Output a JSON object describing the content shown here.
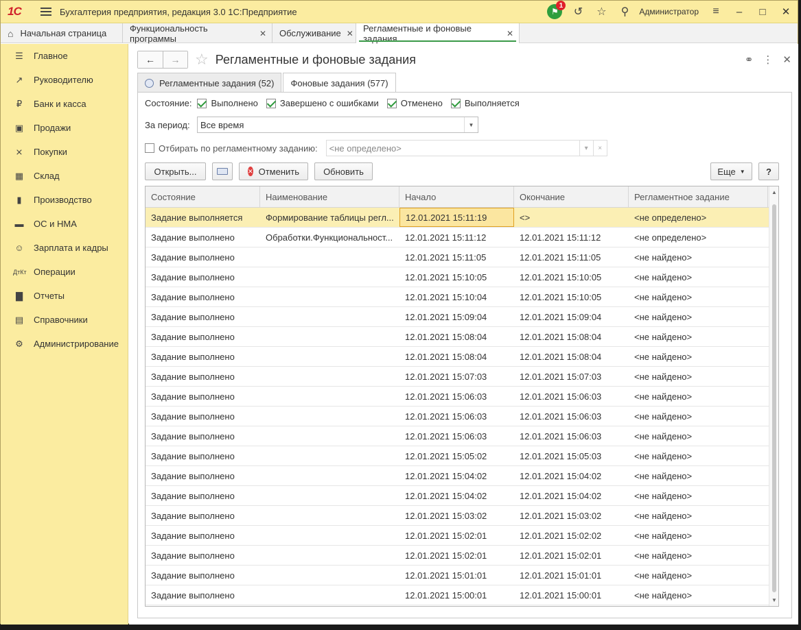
{
  "titlebar": {
    "app_title": "Бухгалтерия предприятия, редакция 3.0 1С:Предприятие",
    "logo_text": "1С",
    "notifications_count": "1",
    "user": "Администратор"
  },
  "tabs": [
    {
      "label": "Начальная страница"
    },
    {
      "label": "Функциональность программы"
    },
    {
      "label": "Обслуживание"
    },
    {
      "label": "Регламентные и фоновые задания"
    }
  ],
  "sidebar": {
    "items": [
      {
        "label": "Главное",
        "icon": "menu-icon"
      },
      {
        "label": "Руководителю",
        "icon": "trend-icon"
      },
      {
        "label": "Банк и касса",
        "icon": "ruble-icon"
      },
      {
        "label": "Продажи",
        "icon": "bag-icon"
      },
      {
        "label": "Покупки",
        "icon": "cart-icon"
      },
      {
        "label": "Склад",
        "icon": "warehouse-icon"
      },
      {
        "label": "Производство",
        "icon": "factory-icon"
      },
      {
        "label": "ОС и НМА",
        "icon": "truck-icon"
      },
      {
        "label": "Зарплата и кадры",
        "icon": "people-icon"
      },
      {
        "label": "Операции",
        "icon": "dt-kt-icon"
      },
      {
        "label": "Отчеты",
        "icon": "bar-chart-icon"
      },
      {
        "label": "Справочники",
        "icon": "books-icon"
      },
      {
        "label": "Администрирование",
        "icon": "gear-icon"
      }
    ]
  },
  "form": {
    "title": "Регламентные и фоновые задания",
    "subtabs": [
      {
        "label": "Регламентные задания (52)"
      },
      {
        "label": "Фоновые задания (577)"
      }
    ],
    "filters": {
      "state_label": "Состояние:",
      "states": [
        {
          "label": "Выполнено",
          "checked": true
        },
        {
          "label": "Завершено с ошибками",
          "checked": true
        },
        {
          "label": "Отменено",
          "checked": true
        },
        {
          "label": "Выполняется",
          "checked": true
        }
      ],
      "period_label": "За период:",
      "period_value": "Все время",
      "by_scheduled_label": "Отбирать по регламентному заданию:",
      "by_scheduled_value": "<не определено>"
    },
    "buttons": {
      "open": "Открыть...",
      "cancel": "Отменить",
      "refresh": "Обновить",
      "more": "Еще",
      "help": "?"
    },
    "table": {
      "columns": [
        "Состояние",
        "Наименование",
        "Начало",
        "Окончание",
        "Регламентное задание"
      ],
      "rows": [
        [
          "Задание выполняется",
          "Формирование таблицы регл...",
          "12.01.2021 15:11:19",
          "<>",
          "<не определено>"
        ],
        [
          "Задание выполнено",
          "Обработки.Функциональност...",
          "12.01.2021 15:11:12",
          "12.01.2021 15:11:12",
          "<не определено>"
        ],
        [
          "Задание выполнено",
          "",
          "12.01.2021 15:11:05",
          "12.01.2021 15:11:05",
          "<не найдено>"
        ],
        [
          "Задание выполнено",
          "",
          "12.01.2021 15:10:05",
          "12.01.2021 15:10:05",
          "<не найдено>"
        ],
        [
          "Задание выполнено",
          "",
          "12.01.2021 15:10:04",
          "12.01.2021 15:10:05",
          "<не найдено>"
        ],
        [
          "Задание выполнено",
          "",
          "12.01.2021 15:09:04",
          "12.01.2021 15:09:04",
          "<не найдено>"
        ],
        [
          "Задание выполнено",
          "",
          "12.01.2021 15:08:04",
          "12.01.2021 15:08:04",
          "<не найдено>"
        ],
        [
          "Задание выполнено",
          "",
          "12.01.2021 15:08:04",
          "12.01.2021 15:08:04",
          "<не найдено>"
        ],
        [
          "Задание выполнено",
          "",
          "12.01.2021 15:07:03",
          "12.01.2021 15:07:03",
          "<не найдено>"
        ],
        [
          "Задание выполнено",
          "",
          "12.01.2021 15:06:03",
          "12.01.2021 15:06:03",
          "<не найдено>"
        ],
        [
          "Задание выполнено",
          "",
          "12.01.2021 15:06:03",
          "12.01.2021 15:06:03",
          "<не найдено>"
        ],
        [
          "Задание выполнено",
          "",
          "12.01.2021 15:06:03",
          "12.01.2021 15:06:03",
          "<не найдено>"
        ],
        [
          "Задание выполнено",
          "",
          "12.01.2021 15:05:02",
          "12.01.2021 15:05:03",
          "<не найдено>"
        ],
        [
          "Задание выполнено",
          "",
          "12.01.2021 15:04:02",
          "12.01.2021 15:04:02",
          "<не найдено>"
        ],
        [
          "Задание выполнено",
          "",
          "12.01.2021 15:04:02",
          "12.01.2021 15:04:02",
          "<не найдено>"
        ],
        [
          "Задание выполнено",
          "",
          "12.01.2021 15:03:02",
          "12.01.2021 15:03:02",
          "<не найдено>"
        ],
        [
          "Задание выполнено",
          "",
          "12.01.2021 15:02:01",
          "12.01.2021 15:02:02",
          "<не найдено>"
        ],
        [
          "Задание выполнено",
          "",
          "12.01.2021 15:02:01",
          "12.01.2021 15:02:01",
          "<не найдено>"
        ],
        [
          "Задание выполнено",
          "",
          "12.01.2021 15:01:01",
          "12.01.2021 15:01:01",
          "<не найдено>"
        ],
        [
          "Задание выполнено",
          "",
          "12.01.2021 15:00:01",
          "12.01.2021 15:00:01",
          "<не найдено>"
        ]
      ]
    }
  },
  "colors": {
    "sidebar_bg": "#fbeca0",
    "accent_green": "#3a9a48",
    "selected_row": "#fbefb4",
    "brand_red": "#d0202a"
  }
}
